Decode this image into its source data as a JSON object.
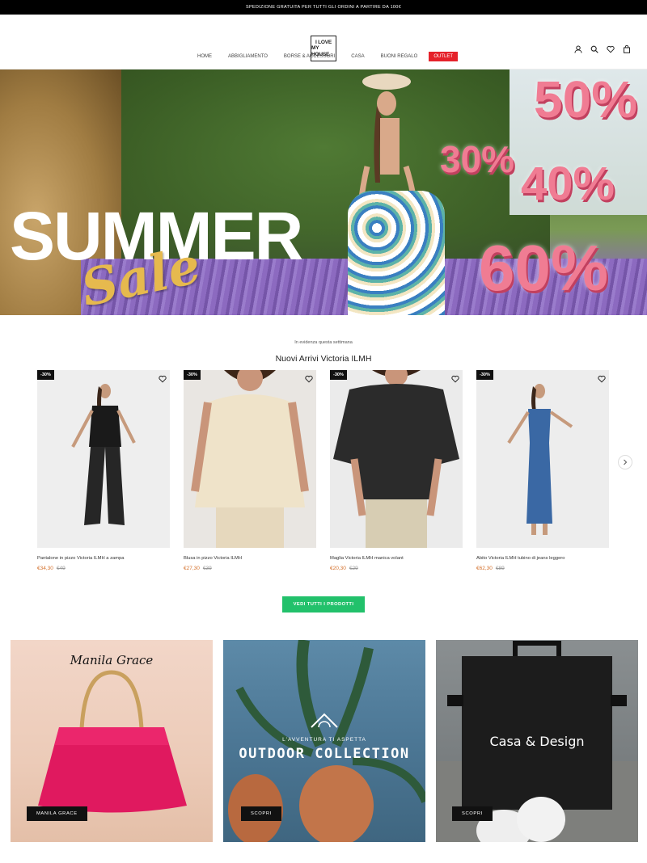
{
  "announcement": "SPEDIZIONE GRATUITA PER TUTTI GLI ORDINI A PARTIRE DA 100€",
  "logo": {
    "line1": "I LOVE",
    "line2": "MY HOUSE"
  },
  "header_icons": [
    "user-icon",
    "search-icon",
    "heart-icon",
    "bag-icon"
  ],
  "nav": {
    "items": [
      "HOME",
      "ABBIGLIAMENTO",
      "BORSE & ACCESSORI",
      "CASA",
      "BUONI REGALO"
    ],
    "outlet": "OUTLET"
  },
  "hero": {
    "headline": "SUMMER",
    "script": "Sale",
    "percents": [
      "50%",
      "30%",
      "40%",
      "60%"
    ]
  },
  "featured": {
    "subtitle": "In evidenza questa settimana",
    "title": "Nuovi Arrivi Victoria ILMH",
    "products": [
      {
        "badge": "-30%",
        "name": "Pantalone in pizzo Victoria ILMH a zampa",
        "price": "€34,30",
        "old_price": "€49"
      },
      {
        "badge": "-30%",
        "name": "Blusa in pizzo Victoria ILMH",
        "price": "€27,30",
        "old_price": "€39"
      },
      {
        "badge": "-30%",
        "name": "Maglia Victoria ILMH manica volant",
        "price": "€20,30",
        "old_price": "€29"
      },
      {
        "badge": "-30%",
        "name": "Abito Victoria ILMH tubino di jeans leggero",
        "price": "€62,30",
        "old_price": "€89"
      }
    ],
    "cta": "VEDI TUTTI I PRODOTTI"
  },
  "collections": [
    {
      "brand_text": "Manila Grace",
      "button": "MANILA GRACE"
    },
    {
      "kicker": "L'AVVENTURA TI ASPETTA",
      "title": "OUTDOOR COLLECTION",
      "button": "SCOPRI"
    },
    {
      "title": "Casa & Design",
      "button": "SCOPRI"
    }
  ],
  "colors": {
    "outlet_red": "#e5222a",
    "cta_green": "#22c16b",
    "price_orange": "#d4712c"
  }
}
